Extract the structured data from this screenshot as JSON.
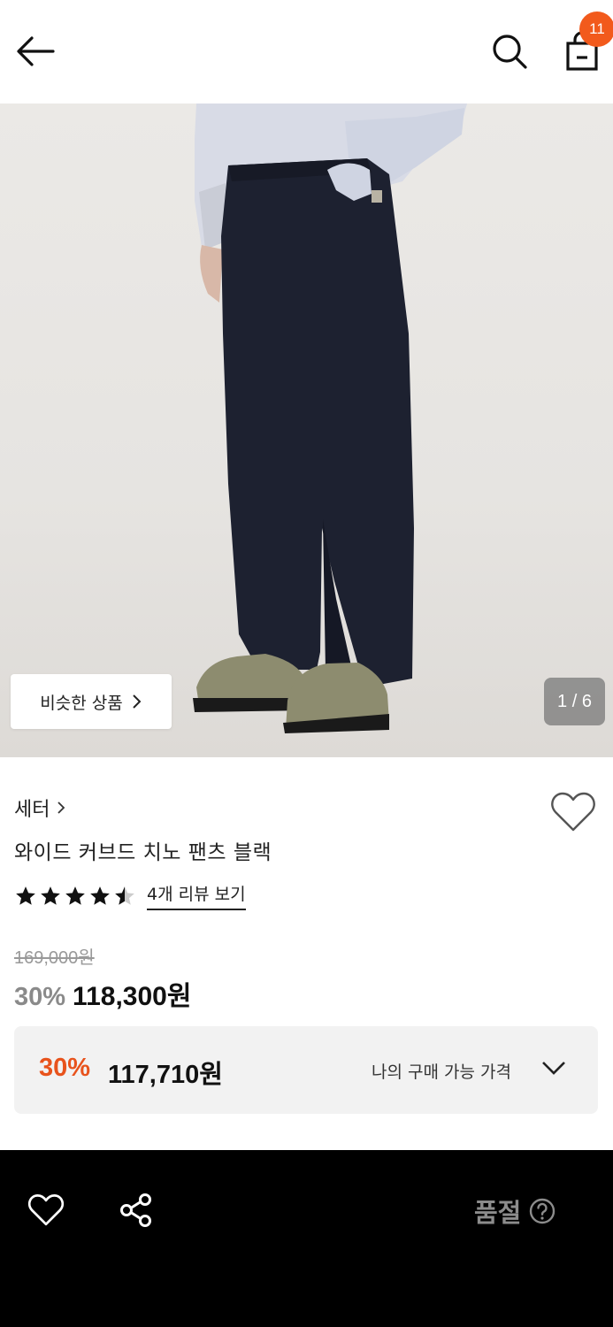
{
  "header": {
    "back_icon": "arrow-left-icon",
    "search_icon": "search-icon",
    "cart_icon": "shopping-bag-icon",
    "cart_count": "11",
    "badge_color": "#f25a1c"
  },
  "gallery": {
    "similar_label": "비슷한 상품",
    "similar_icon": "chevron-right-icon",
    "page_indicator": "1 / 6"
  },
  "product": {
    "brand": "세터",
    "brand_icon": "chevron-right-icon",
    "name": "와이드 커브드 치노 팬츠 블랙",
    "rating": 4.5,
    "review_link": "4개 리뷰 보기",
    "original_price": "169,000원",
    "discount": "30%",
    "sale_price": "118,300원"
  },
  "my_price": {
    "discount": "30%",
    "price": "117,710원",
    "label": "나의 구매 가능 가격",
    "accent_color": "#e8531c"
  },
  "bottom_bar": {
    "like_icon": "heart-outline-icon",
    "share_icon": "share-icon",
    "soldout_label": "품절",
    "help_icon": "question-circle-icon"
  }
}
